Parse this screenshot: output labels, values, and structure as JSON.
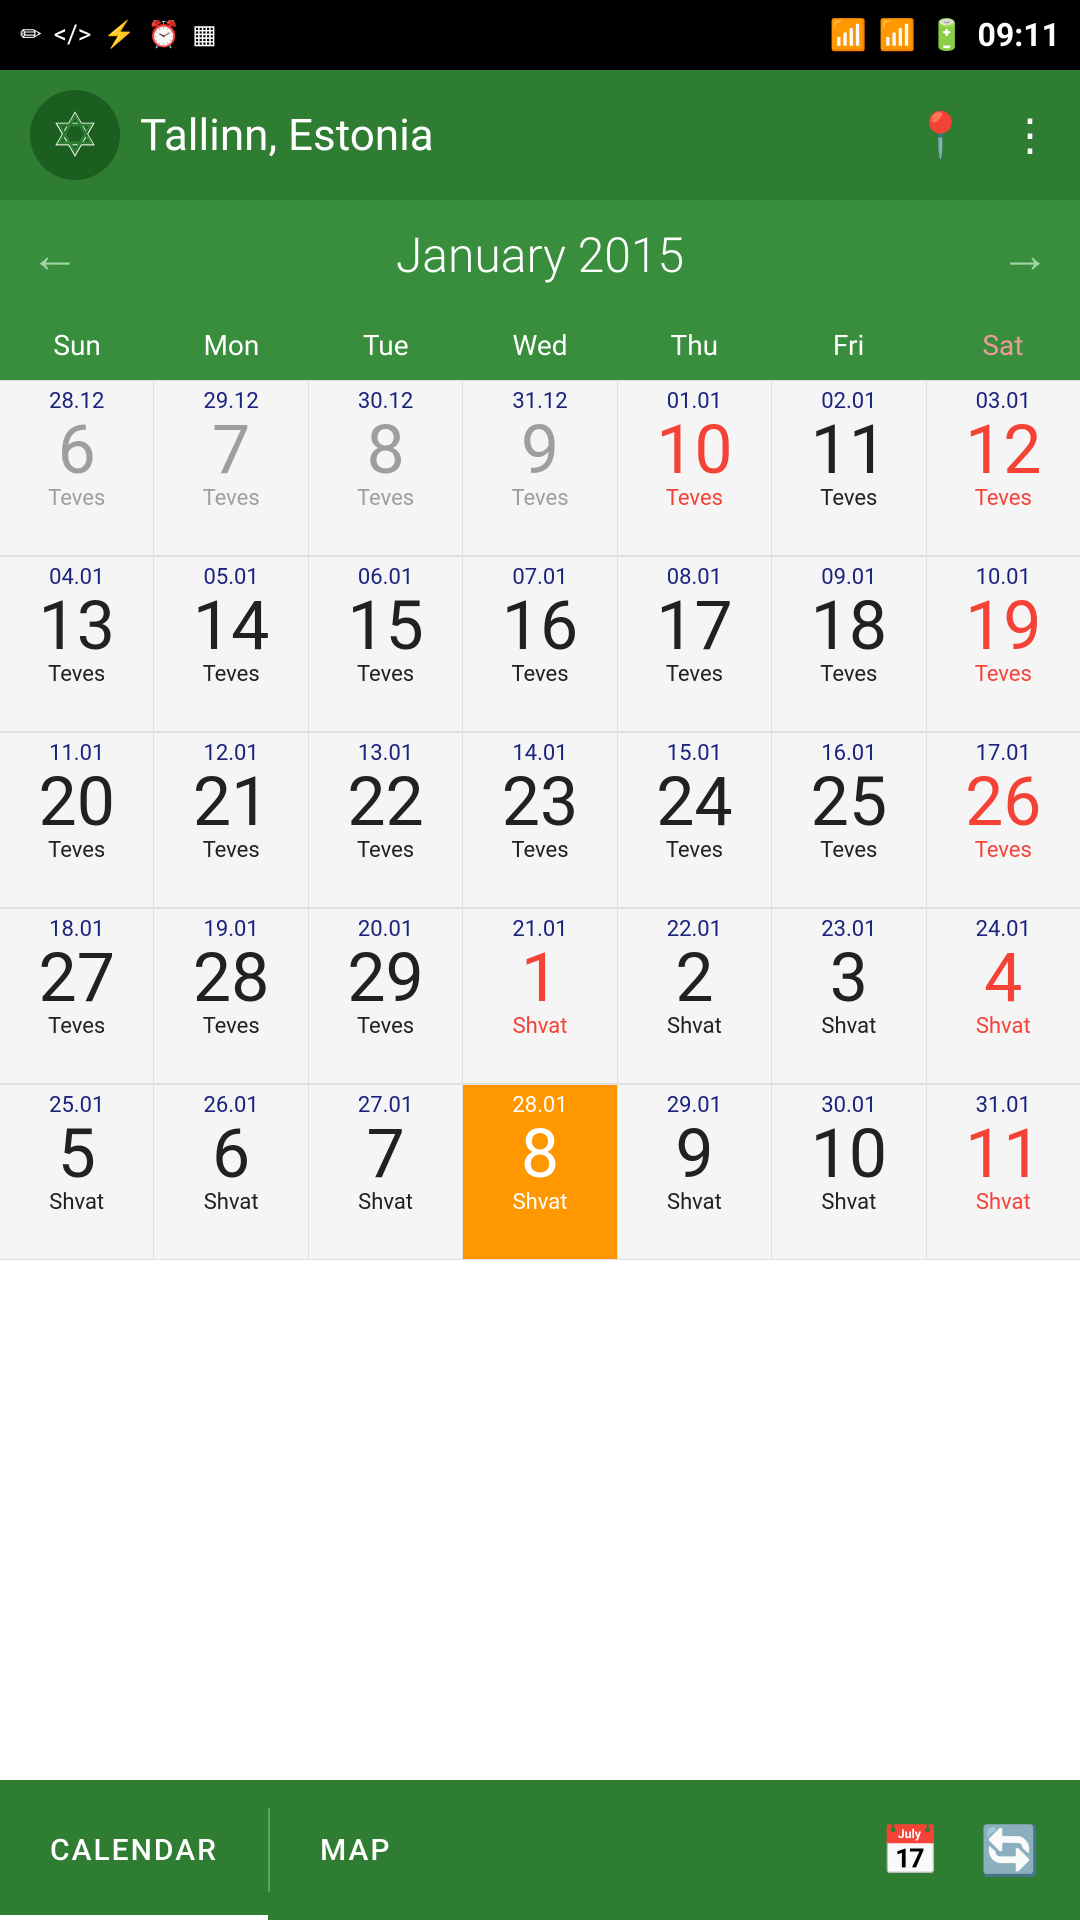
{
  "statusBar": {
    "time": "09:11",
    "leftIcons": [
      "✏",
      "⌨",
      "⚡",
      "⏰",
      "▦"
    ],
    "rightIcons": [
      "wifi",
      "signal",
      "battery"
    ]
  },
  "header": {
    "logoAlt": "Jewish Calendar App",
    "title": "Tallinn, Estonia",
    "locationLabel": "location",
    "menuLabel": "more options"
  },
  "monthNav": {
    "prevLabel": "←",
    "nextLabel": "→",
    "title": "January 2015"
  },
  "dayHeaders": [
    {
      "label": "Sun",
      "type": "sunday"
    },
    {
      "label": "Mon",
      "type": "weekday"
    },
    {
      "label": "Tue",
      "type": "weekday"
    },
    {
      "label": "Wed",
      "type": "weekday"
    },
    {
      "label": "Thu",
      "type": "weekday"
    },
    {
      "label": "Fri",
      "type": "weekday"
    },
    {
      "label": "Sat",
      "type": "saturday"
    }
  ],
  "calendarWeeks": [
    {
      "days": [
        {
          "gregDate": "28.12",
          "dayNum": "6",
          "dayNumColor": "gray",
          "hebrew": "Teves",
          "hebrewColor": "gray"
        },
        {
          "gregDate": "29.12",
          "dayNum": "7",
          "dayNumColor": "gray",
          "hebrew": "Teves",
          "hebrewColor": "gray"
        },
        {
          "gregDate": "30.12",
          "dayNum": "8",
          "dayNumColor": "gray",
          "hebrew": "Teves",
          "hebrewColor": "gray"
        },
        {
          "gregDate": "31.12",
          "dayNum": "9",
          "dayNumColor": "gray",
          "hebrew": "Teves",
          "hebrewColor": "gray"
        },
        {
          "gregDate": "01.01",
          "dayNum": "10",
          "dayNumColor": "red",
          "hebrew": "Teves",
          "hebrewColor": "red"
        },
        {
          "gregDate": "02.01",
          "dayNum": "11",
          "dayNumColor": "black",
          "hebrew": "Teves",
          "hebrewColor": "black"
        },
        {
          "gregDate": "03.01",
          "dayNum": "12",
          "dayNumColor": "red",
          "hebrew": "Teves",
          "hebrewColor": "red"
        }
      ]
    },
    {
      "days": [
        {
          "gregDate": "04.01",
          "dayNum": "13",
          "dayNumColor": "black",
          "hebrew": "Teves",
          "hebrewColor": "black"
        },
        {
          "gregDate": "05.01",
          "dayNum": "14",
          "dayNumColor": "black",
          "hebrew": "Teves",
          "hebrewColor": "black"
        },
        {
          "gregDate": "06.01",
          "dayNum": "15",
          "dayNumColor": "black",
          "hebrew": "Teves",
          "hebrewColor": "black"
        },
        {
          "gregDate": "07.01",
          "dayNum": "16",
          "dayNumColor": "black",
          "hebrew": "Teves",
          "hebrewColor": "black"
        },
        {
          "gregDate": "08.01",
          "dayNum": "17",
          "dayNumColor": "black",
          "hebrew": "Teves",
          "hebrewColor": "black"
        },
        {
          "gregDate": "09.01",
          "dayNum": "18",
          "dayNumColor": "black",
          "hebrew": "Teves",
          "hebrewColor": "black"
        },
        {
          "gregDate": "10.01",
          "dayNum": "19",
          "dayNumColor": "red",
          "hebrew": "Teves",
          "hebrewColor": "red"
        }
      ]
    },
    {
      "days": [
        {
          "gregDate": "11.01",
          "dayNum": "20",
          "dayNumColor": "black",
          "hebrew": "Teves",
          "hebrewColor": "black"
        },
        {
          "gregDate": "12.01",
          "dayNum": "21",
          "dayNumColor": "black",
          "hebrew": "Teves",
          "hebrewColor": "black"
        },
        {
          "gregDate": "13.01",
          "dayNum": "22",
          "dayNumColor": "black",
          "hebrew": "Teves",
          "hebrewColor": "black"
        },
        {
          "gregDate": "14.01",
          "dayNum": "23",
          "dayNumColor": "black",
          "hebrew": "Teves",
          "hebrewColor": "black"
        },
        {
          "gregDate": "15.01",
          "dayNum": "24",
          "dayNumColor": "black",
          "hebrew": "Teves",
          "hebrewColor": "black"
        },
        {
          "gregDate": "16.01",
          "dayNum": "25",
          "dayNumColor": "black",
          "hebrew": "Teves",
          "hebrewColor": "black"
        },
        {
          "gregDate": "17.01",
          "dayNum": "26",
          "dayNumColor": "red",
          "hebrew": "Teves",
          "hebrewColor": "red"
        }
      ]
    },
    {
      "days": [
        {
          "gregDate": "18.01",
          "dayNum": "27",
          "dayNumColor": "black",
          "hebrew": "Teves",
          "hebrewColor": "black"
        },
        {
          "gregDate": "19.01",
          "dayNum": "28",
          "dayNumColor": "black",
          "hebrew": "Teves",
          "hebrewColor": "black"
        },
        {
          "gregDate": "20.01",
          "dayNum": "29",
          "dayNumColor": "black",
          "hebrew": "Teves",
          "hebrewColor": "black"
        },
        {
          "gregDate": "21.01",
          "dayNum": "1",
          "dayNumColor": "red",
          "hebrew": "Shvat",
          "hebrewColor": "red"
        },
        {
          "gregDate": "22.01",
          "dayNum": "2",
          "dayNumColor": "black",
          "hebrew": "Shvat",
          "hebrewColor": "black"
        },
        {
          "gregDate": "23.01",
          "dayNum": "3",
          "dayNumColor": "black",
          "hebrew": "Shvat",
          "hebrewColor": "black"
        },
        {
          "gregDate": "24.01",
          "dayNum": "4",
          "dayNumColor": "red",
          "hebrew": "Shvat",
          "hebrewColor": "red"
        }
      ]
    },
    {
      "days": [
        {
          "gregDate": "25.01",
          "dayNum": "5",
          "dayNumColor": "black",
          "hebrew": "Shvat",
          "hebrewColor": "black"
        },
        {
          "gregDate": "26.01",
          "dayNum": "6",
          "dayNumColor": "black",
          "hebrew": "Shvat",
          "hebrewColor": "black"
        },
        {
          "gregDate": "27.01",
          "dayNum": "7",
          "dayNumColor": "black",
          "hebrew": "Shvat",
          "hebrewColor": "black"
        },
        {
          "gregDate": "28.01",
          "dayNum": "8",
          "dayNumColor": "today",
          "hebrew": "Shvat",
          "hebrewColor": "today",
          "isToday": true
        },
        {
          "gregDate": "29.01",
          "dayNum": "9",
          "dayNumColor": "black",
          "hebrew": "Shvat",
          "hebrewColor": "black"
        },
        {
          "gregDate": "30.01",
          "dayNum": "10",
          "dayNumColor": "black",
          "hebrew": "Shvat",
          "hebrewColor": "black"
        },
        {
          "gregDate": "31.01",
          "dayNum": "11",
          "dayNumColor": "red",
          "hebrew": "Shvat",
          "hebrewColor": "red"
        }
      ]
    }
  ],
  "bottomNav": {
    "tabs": [
      {
        "label": "CALENDAR",
        "active": true
      },
      {
        "label": "MAP",
        "active": false
      }
    ],
    "icons": [
      "calendar-today",
      "refresh"
    ]
  }
}
